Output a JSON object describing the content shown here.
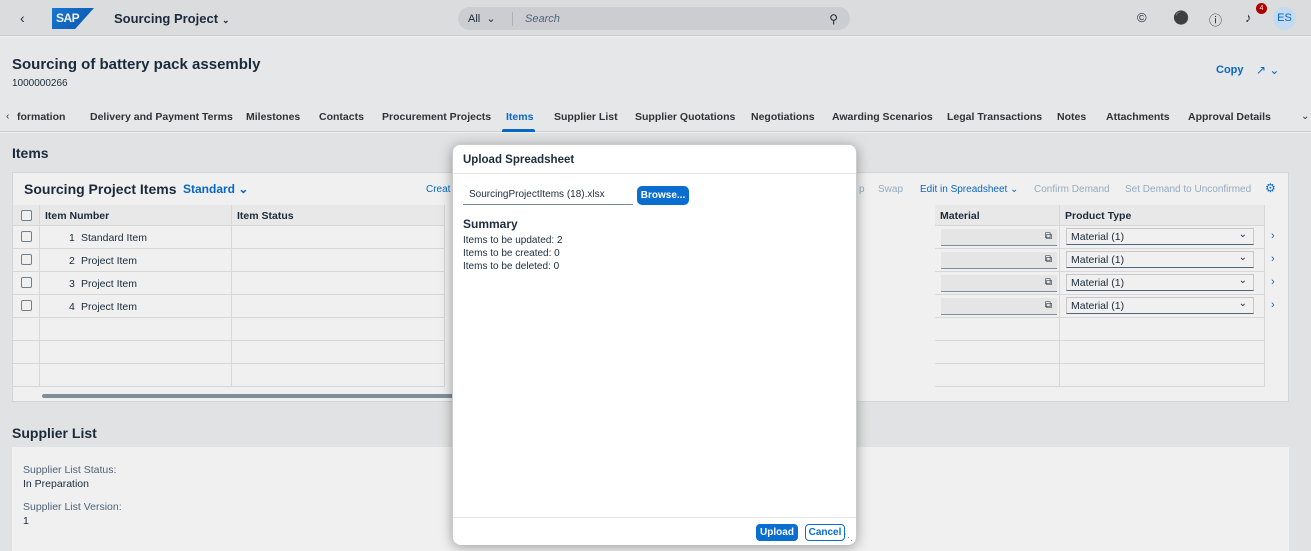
{
  "shell": {
    "app_title": "Sourcing Project",
    "logo_text": "SAP",
    "search_scope": "All",
    "search_placeholder": "Search",
    "notification_count": "4",
    "user_initials": "ES"
  },
  "object": {
    "title": "Sourcing of battery pack assembly",
    "id": "1000000266",
    "copy_label": "Copy"
  },
  "tabs": [
    "formation",
    "Delivery and Payment Terms",
    "Milestones",
    "Contacts",
    "Procurement Projects",
    "Items",
    "Supplier List",
    "Supplier Quotations",
    "Negotiations",
    "Awarding Scenarios",
    "Legal Transactions",
    "Notes",
    "Attachments",
    "Approval Details"
  ],
  "items_section": {
    "title": "Items",
    "table_title": "Sourcing Project Items",
    "variant": "Standard",
    "actions": {
      "create": "Creat",
      "p": "p",
      "swap": "Swap",
      "edit_in_spreadsheet": "Edit in Spreadsheet",
      "confirm_demand": "Confirm Demand",
      "set_demand_unconfirmed": "Set Demand to Unconfirmed"
    },
    "columns": {
      "item_number": "Item Number",
      "item_status": "Item Status",
      "material": "Material",
      "product_type": "Product Type"
    },
    "rows": [
      {
        "num": "1",
        "name": "Standard Item",
        "product_type": "Material (1)"
      },
      {
        "num": "2",
        "name": "Project Item",
        "product_type": "Material (1)"
      },
      {
        "num": "3",
        "name": "Project Item",
        "product_type": "Material (1)"
      },
      {
        "num": "4",
        "name": "Project Item",
        "product_type": "Material (1)"
      }
    ]
  },
  "supplier_section": {
    "title": "Supplier List",
    "status_label": "Supplier List Status:",
    "status_value": "In Preparation",
    "version_label": "Supplier List Version:",
    "version_value": "1"
  },
  "dialog": {
    "title": "Upload Spreadsheet",
    "file_name": "SourcingProjectItems (18).xlsx",
    "browse_label": "Browse...",
    "summary_title": "Summary",
    "summary_lines": [
      "Items to be updated: 2",
      "Items to be created: 0",
      "Items to be deleted: 0"
    ],
    "upload_label": "Upload",
    "cancel_label": "Cancel"
  }
}
